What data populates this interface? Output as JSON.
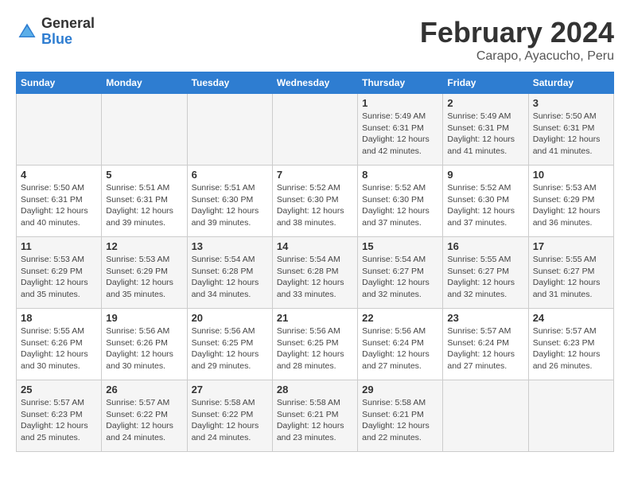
{
  "logo": {
    "text_general": "General",
    "text_blue": "Blue"
  },
  "header": {
    "title": "February 2024",
    "subtitle": "Carapo, Ayacucho, Peru"
  },
  "columns": [
    "Sunday",
    "Monday",
    "Tuesday",
    "Wednesday",
    "Thursday",
    "Friday",
    "Saturday"
  ],
  "weeks": [
    [
      {
        "day": "",
        "info": ""
      },
      {
        "day": "",
        "info": ""
      },
      {
        "day": "",
        "info": ""
      },
      {
        "day": "",
        "info": ""
      },
      {
        "day": "1",
        "info": "Sunrise: 5:49 AM\nSunset: 6:31 PM\nDaylight: 12 hours and 42 minutes."
      },
      {
        "day": "2",
        "info": "Sunrise: 5:49 AM\nSunset: 6:31 PM\nDaylight: 12 hours and 41 minutes."
      },
      {
        "day": "3",
        "info": "Sunrise: 5:50 AM\nSunset: 6:31 PM\nDaylight: 12 hours and 41 minutes."
      }
    ],
    [
      {
        "day": "4",
        "info": "Sunrise: 5:50 AM\nSunset: 6:31 PM\nDaylight: 12 hours and 40 minutes."
      },
      {
        "day": "5",
        "info": "Sunrise: 5:51 AM\nSunset: 6:31 PM\nDaylight: 12 hours and 39 minutes."
      },
      {
        "day": "6",
        "info": "Sunrise: 5:51 AM\nSunset: 6:30 PM\nDaylight: 12 hours and 39 minutes."
      },
      {
        "day": "7",
        "info": "Sunrise: 5:52 AM\nSunset: 6:30 PM\nDaylight: 12 hours and 38 minutes."
      },
      {
        "day": "8",
        "info": "Sunrise: 5:52 AM\nSunset: 6:30 PM\nDaylight: 12 hours and 37 minutes."
      },
      {
        "day": "9",
        "info": "Sunrise: 5:52 AM\nSunset: 6:30 PM\nDaylight: 12 hours and 37 minutes."
      },
      {
        "day": "10",
        "info": "Sunrise: 5:53 AM\nSunset: 6:29 PM\nDaylight: 12 hours and 36 minutes."
      }
    ],
    [
      {
        "day": "11",
        "info": "Sunrise: 5:53 AM\nSunset: 6:29 PM\nDaylight: 12 hours and 35 minutes."
      },
      {
        "day": "12",
        "info": "Sunrise: 5:53 AM\nSunset: 6:29 PM\nDaylight: 12 hours and 35 minutes."
      },
      {
        "day": "13",
        "info": "Sunrise: 5:54 AM\nSunset: 6:28 PM\nDaylight: 12 hours and 34 minutes."
      },
      {
        "day": "14",
        "info": "Sunrise: 5:54 AM\nSunset: 6:28 PM\nDaylight: 12 hours and 33 minutes."
      },
      {
        "day": "15",
        "info": "Sunrise: 5:54 AM\nSunset: 6:27 PM\nDaylight: 12 hours and 32 minutes."
      },
      {
        "day": "16",
        "info": "Sunrise: 5:55 AM\nSunset: 6:27 PM\nDaylight: 12 hours and 32 minutes."
      },
      {
        "day": "17",
        "info": "Sunrise: 5:55 AM\nSunset: 6:27 PM\nDaylight: 12 hours and 31 minutes."
      }
    ],
    [
      {
        "day": "18",
        "info": "Sunrise: 5:55 AM\nSunset: 6:26 PM\nDaylight: 12 hours and 30 minutes."
      },
      {
        "day": "19",
        "info": "Sunrise: 5:56 AM\nSunset: 6:26 PM\nDaylight: 12 hours and 30 minutes."
      },
      {
        "day": "20",
        "info": "Sunrise: 5:56 AM\nSunset: 6:25 PM\nDaylight: 12 hours and 29 minutes."
      },
      {
        "day": "21",
        "info": "Sunrise: 5:56 AM\nSunset: 6:25 PM\nDaylight: 12 hours and 28 minutes."
      },
      {
        "day": "22",
        "info": "Sunrise: 5:56 AM\nSunset: 6:24 PM\nDaylight: 12 hours and 27 minutes."
      },
      {
        "day": "23",
        "info": "Sunrise: 5:57 AM\nSunset: 6:24 PM\nDaylight: 12 hours and 27 minutes."
      },
      {
        "day": "24",
        "info": "Sunrise: 5:57 AM\nSunset: 6:23 PM\nDaylight: 12 hours and 26 minutes."
      }
    ],
    [
      {
        "day": "25",
        "info": "Sunrise: 5:57 AM\nSunset: 6:23 PM\nDaylight: 12 hours and 25 minutes."
      },
      {
        "day": "26",
        "info": "Sunrise: 5:57 AM\nSunset: 6:22 PM\nDaylight: 12 hours and 24 minutes."
      },
      {
        "day": "27",
        "info": "Sunrise: 5:58 AM\nSunset: 6:22 PM\nDaylight: 12 hours and 24 minutes."
      },
      {
        "day": "28",
        "info": "Sunrise: 5:58 AM\nSunset: 6:21 PM\nDaylight: 12 hours and 23 minutes."
      },
      {
        "day": "29",
        "info": "Sunrise: 5:58 AM\nSunset: 6:21 PM\nDaylight: 12 hours and 22 minutes."
      },
      {
        "day": "",
        "info": ""
      },
      {
        "day": "",
        "info": ""
      }
    ]
  ]
}
